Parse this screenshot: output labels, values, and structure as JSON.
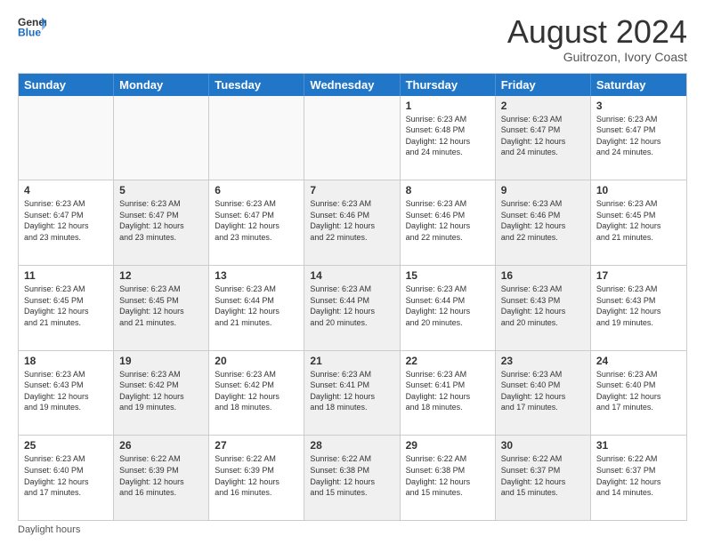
{
  "header": {
    "logo_line1": "General",
    "logo_line2": "Blue",
    "month_year": "August 2024",
    "location": "Guitrozon, Ivory Coast"
  },
  "days_of_week": [
    "Sunday",
    "Monday",
    "Tuesday",
    "Wednesday",
    "Thursday",
    "Friday",
    "Saturday"
  ],
  "weeks": [
    [
      {
        "day": "",
        "info": "",
        "shaded": false,
        "empty": true
      },
      {
        "day": "",
        "info": "",
        "shaded": false,
        "empty": true
      },
      {
        "day": "",
        "info": "",
        "shaded": false,
        "empty": true
      },
      {
        "day": "",
        "info": "",
        "shaded": false,
        "empty": true
      },
      {
        "day": "1",
        "info": "Sunrise: 6:23 AM\nSunset: 6:48 PM\nDaylight: 12 hours\nand 24 minutes.",
        "shaded": false,
        "empty": false
      },
      {
        "day": "2",
        "info": "Sunrise: 6:23 AM\nSunset: 6:47 PM\nDaylight: 12 hours\nand 24 minutes.",
        "shaded": true,
        "empty": false
      },
      {
        "day": "3",
        "info": "Sunrise: 6:23 AM\nSunset: 6:47 PM\nDaylight: 12 hours\nand 24 minutes.",
        "shaded": false,
        "empty": false
      }
    ],
    [
      {
        "day": "4",
        "info": "Sunrise: 6:23 AM\nSunset: 6:47 PM\nDaylight: 12 hours\nand 23 minutes.",
        "shaded": false,
        "empty": false
      },
      {
        "day": "5",
        "info": "Sunrise: 6:23 AM\nSunset: 6:47 PM\nDaylight: 12 hours\nand 23 minutes.",
        "shaded": true,
        "empty": false
      },
      {
        "day": "6",
        "info": "Sunrise: 6:23 AM\nSunset: 6:47 PM\nDaylight: 12 hours\nand 23 minutes.",
        "shaded": false,
        "empty": false
      },
      {
        "day": "7",
        "info": "Sunrise: 6:23 AM\nSunset: 6:46 PM\nDaylight: 12 hours\nand 22 minutes.",
        "shaded": true,
        "empty": false
      },
      {
        "day": "8",
        "info": "Sunrise: 6:23 AM\nSunset: 6:46 PM\nDaylight: 12 hours\nand 22 minutes.",
        "shaded": false,
        "empty": false
      },
      {
        "day": "9",
        "info": "Sunrise: 6:23 AM\nSunset: 6:46 PM\nDaylight: 12 hours\nand 22 minutes.",
        "shaded": true,
        "empty": false
      },
      {
        "day": "10",
        "info": "Sunrise: 6:23 AM\nSunset: 6:45 PM\nDaylight: 12 hours\nand 21 minutes.",
        "shaded": false,
        "empty": false
      }
    ],
    [
      {
        "day": "11",
        "info": "Sunrise: 6:23 AM\nSunset: 6:45 PM\nDaylight: 12 hours\nand 21 minutes.",
        "shaded": false,
        "empty": false
      },
      {
        "day": "12",
        "info": "Sunrise: 6:23 AM\nSunset: 6:45 PM\nDaylight: 12 hours\nand 21 minutes.",
        "shaded": true,
        "empty": false
      },
      {
        "day": "13",
        "info": "Sunrise: 6:23 AM\nSunset: 6:44 PM\nDaylight: 12 hours\nand 21 minutes.",
        "shaded": false,
        "empty": false
      },
      {
        "day": "14",
        "info": "Sunrise: 6:23 AM\nSunset: 6:44 PM\nDaylight: 12 hours\nand 20 minutes.",
        "shaded": true,
        "empty": false
      },
      {
        "day": "15",
        "info": "Sunrise: 6:23 AM\nSunset: 6:44 PM\nDaylight: 12 hours\nand 20 minutes.",
        "shaded": false,
        "empty": false
      },
      {
        "day": "16",
        "info": "Sunrise: 6:23 AM\nSunset: 6:43 PM\nDaylight: 12 hours\nand 20 minutes.",
        "shaded": true,
        "empty": false
      },
      {
        "day": "17",
        "info": "Sunrise: 6:23 AM\nSunset: 6:43 PM\nDaylight: 12 hours\nand 19 minutes.",
        "shaded": false,
        "empty": false
      }
    ],
    [
      {
        "day": "18",
        "info": "Sunrise: 6:23 AM\nSunset: 6:43 PM\nDaylight: 12 hours\nand 19 minutes.",
        "shaded": false,
        "empty": false
      },
      {
        "day": "19",
        "info": "Sunrise: 6:23 AM\nSunset: 6:42 PM\nDaylight: 12 hours\nand 19 minutes.",
        "shaded": true,
        "empty": false
      },
      {
        "day": "20",
        "info": "Sunrise: 6:23 AM\nSunset: 6:42 PM\nDaylight: 12 hours\nand 18 minutes.",
        "shaded": false,
        "empty": false
      },
      {
        "day": "21",
        "info": "Sunrise: 6:23 AM\nSunset: 6:41 PM\nDaylight: 12 hours\nand 18 minutes.",
        "shaded": true,
        "empty": false
      },
      {
        "day": "22",
        "info": "Sunrise: 6:23 AM\nSunset: 6:41 PM\nDaylight: 12 hours\nand 18 minutes.",
        "shaded": false,
        "empty": false
      },
      {
        "day": "23",
        "info": "Sunrise: 6:23 AM\nSunset: 6:40 PM\nDaylight: 12 hours\nand 17 minutes.",
        "shaded": true,
        "empty": false
      },
      {
        "day": "24",
        "info": "Sunrise: 6:23 AM\nSunset: 6:40 PM\nDaylight: 12 hours\nand 17 minutes.",
        "shaded": false,
        "empty": false
      }
    ],
    [
      {
        "day": "25",
        "info": "Sunrise: 6:23 AM\nSunset: 6:40 PM\nDaylight: 12 hours\nand 17 minutes.",
        "shaded": false,
        "empty": false
      },
      {
        "day": "26",
        "info": "Sunrise: 6:22 AM\nSunset: 6:39 PM\nDaylight: 12 hours\nand 16 minutes.",
        "shaded": true,
        "empty": false
      },
      {
        "day": "27",
        "info": "Sunrise: 6:22 AM\nSunset: 6:39 PM\nDaylight: 12 hours\nand 16 minutes.",
        "shaded": false,
        "empty": false
      },
      {
        "day": "28",
        "info": "Sunrise: 6:22 AM\nSunset: 6:38 PM\nDaylight: 12 hours\nand 15 minutes.",
        "shaded": true,
        "empty": false
      },
      {
        "day": "29",
        "info": "Sunrise: 6:22 AM\nSunset: 6:38 PM\nDaylight: 12 hours\nand 15 minutes.",
        "shaded": false,
        "empty": false
      },
      {
        "day": "30",
        "info": "Sunrise: 6:22 AM\nSunset: 6:37 PM\nDaylight: 12 hours\nand 15 minutes.",
        "shaded": true,
        "empty": false
      },
      {
        "day": "31",
        "info": "Sunrise: 6:22 AM\nSunset: 6:37 PM\nDaylight: 12 hours\nand 14 minutes.",
        "shaded": false,
        "empty": false
      }
    ]
  ],
  "footer": {
    "note": "Daylight hours"
  }
}
